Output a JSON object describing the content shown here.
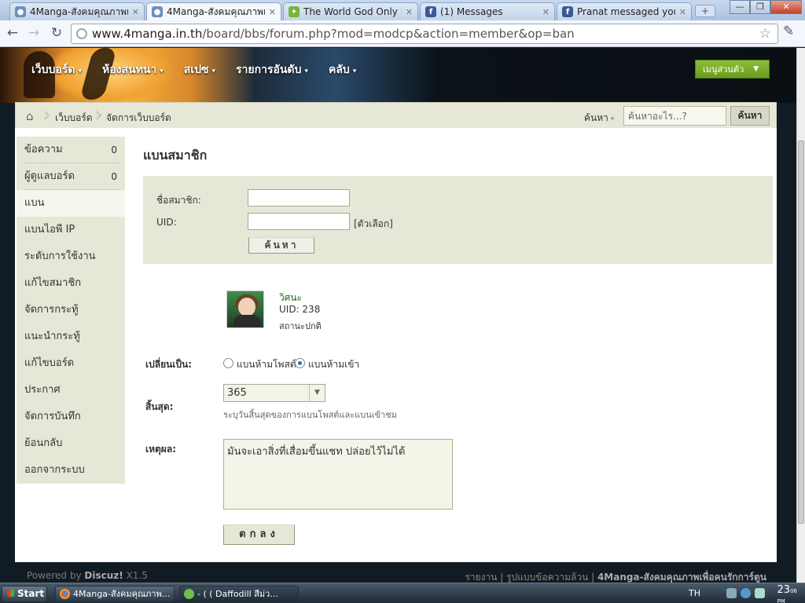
{
  "browser": {
    "tabs": [
      {
        "title": "4Manga-สังคมคุณภาพเพื่อ"
      },
      {
        "title": "4Manga-สังคมคุณภาพเพื่อ"
      },
      {
        "title": "The World God Only Know"
      },
      {
        "title": "(1) Messages"
      },
      {
        "title": "Pranat messaged you"
      }
    ],
    "url_host": "www.4manga.in.th",
    "url_path": "/board/bbs/forum.php?mod=modcp&action=member&op=ban"
  },
  "site": {
    "nav": [
      "เว็บบอร์ด",
      "ห้องสนทนา",
      "สเปซ",
      "รายการอันดับ",
      "คลับ"
    ],
    "user_menu": "เมนูส่วนตัว",
    "breadcrumb": [
      "เว็บบอร์ด",
      "จัดการเว็บบอร์ด"
    ],
    "search_type": "ค้นหา",
    "search_placeholder": "ค้นหาอะไร...?",
    "search_button": "ค้นหา"
  },
  "sidebar": {
    "items": [
      {
        "label": "ข้อความ",
        "count": "0"
      },
      {
        "label": "ผู้ดูแลบอร์ด",
        "count": "0"
      },
      {
        "label": "แบน"
      },
      {
        "label": "แบนไอพี IP"
      },
      {
        "label": "ระดับการใช้งาน"
      },
      {
        "label": "แก้ไขสมาชิก"
      },
      {
        "label": "จัดการกระทู้"
      },
      {
        "label": "แนะนำกระทู้"
      },
      {
        "label": "แก้ไขบอร์ด"
      },
      {
        "label": "ประกาศ"
      },
      {
        "label": "จัดการบันทึก"
      },
      {
        "label": "ย้อนกลับ"
      },
      {
        "label": "ออกจากระบบ"
      }
    ],
    "active_index": 2
  },
  "main": {
    "title": "แบนสมาชิก",
    "form": {
      "username_label": "ชื่อสมาชิก:",
      "uid_label": "UID:",
      "uid_optional": "[ตัวเลือก]",
      "search_button": "ค้นหา"
    },
    "user": {
      "name": "วิศนะ",
      "uid": "UID: 238",
      "status": "สถานะปกติ"
    },
    "change_to_label": "เปลี่ยนเป็น:",
    "change_options": [
      "แบนห้ามโพสต์",
      "แบนห้ามเข้า"
    ],
    "change_selected": "แบนห้ามเข้า",
    "expiry_label": "สิ้นสุด:",
    "expiry_value": "365",
    "expiry_hint": "ระบุวันสิ้นสุดของการแบนโพสต์และแบนเข้าชม",
    "reason_label": "เหตุผล:",
    "reason_value": "มันจะเอาสิ่งที่เสื่อมขึ้นแชท ปล่อยไว้ไม่ได้",
    "submit": "ตกลง"
  },
  "footer": {
    "powered": "Powered by",
    "brand": "Discuz!",
    "version": "X1.5",
    "links": [
      "รายงาน",
      "รูปแบบข้อความล้วน"
    ],
    "site_name": "4Manga-สังคมคุณภาพเพื่อคนรักการ์ตูน"
  },
  "taskbar": {
    "start": "Start",
    "tasks": [
      "4Manga-สังคมคุณภาพ...",
      "-      ( ( Daffodill สีม่ว..."
    ],
    "lang": "TH",
    "time": "23",
    "time_min": "06",
    "time_ampm": "PM"
  },
  "colors": {
    "accent_green": "#6a9d1d",
    "panel": "#e7e7d8"
  }
}
